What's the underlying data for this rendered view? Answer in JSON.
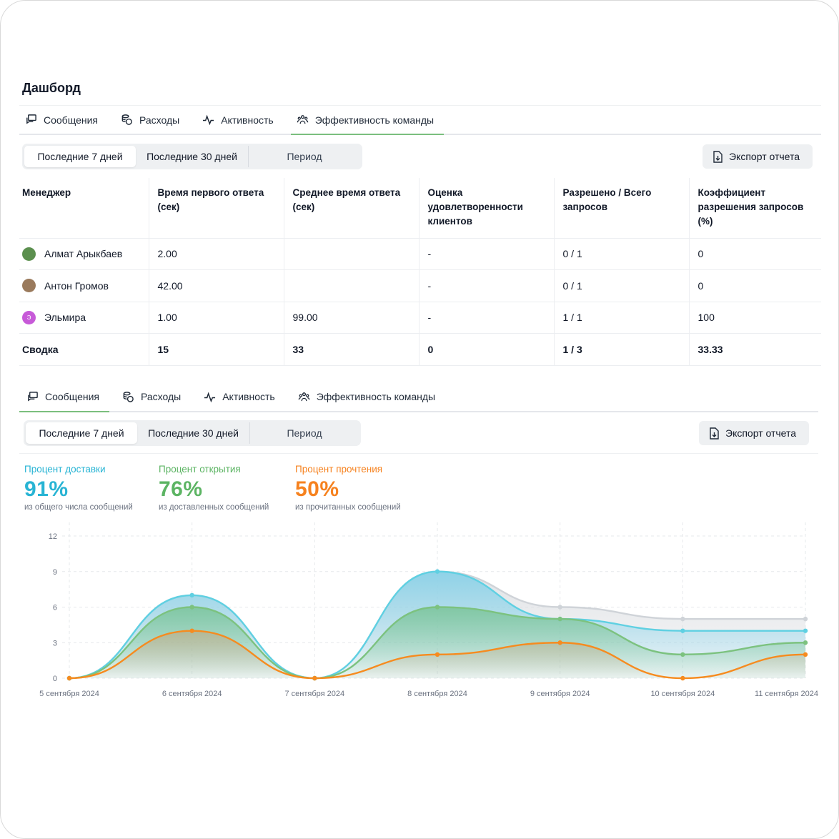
{
  "page_title": "Дашборд",
  "tabs": [
    {
      "label": "Сообщения",
      "icon": "chat-icon"
    },
    {
      "label": "Расходы",
      "icon": "coins-icon"
    },
    {
      "label": "Активность",
      "icon": "pulse-icon"
    },
    {
      "label": "Эффективность команды",
      "icon": "team-icon"
    }
  ],
  "period": {
    "last7": "Последние 7 дней",
    "last30": "Последние 30 дней",
    "custom": "Период"
  },
  "export_label": "Экспорт отчета",
  "table": {
    "headers": [
      "Менеджер",
      "Время первого ответа (сек)",
      "Среднее время ответа (сек)",
      "Оценка удовлетворенности клиентов",
      "Разрешено / Всего запросов",
      "Коэффициент разрешения запросов (%)"
    ],
    "rows": [
      {
        "initial": "",
        "name": "Алмат Арыкбаев",
        "first": "2.00",
        "avg": "",
        "csat": "-",
        "resolved": "0 / 1",
        "rate": "0"
      },
      {
        "initial": "",
        "name": "Антон Громов",
        "first": "42.00",
        "avg": "",
        "csat": "-",
        "resolved": "0 / 1",
        "rate": "0"
      },
      {
        "initial": "Э",
        "name": "Эльмира",
        "first": "1.00",
        "avg": "99.00",
        "csat": "-",
        "resolved": "1 / 1",
        "rate": "100"
      }
    ],
    "summary": {
      "label": "Сводка",
      "first": "15",
      "avg": "33",
      "csat": "0",
      "resolved": "1 / 3",
      "rate": "33.33"
    }
  },
  "metrics": [
    {
      "label": "Процент доставки",
      "value": "91%",
      "sub": "из общего числа сообщений",
      "color": "#28b4d4"
    },
    {
      "label": "Процент открытия",
      "value": "76%",
      "sub": "из доставленных сообщений",
      "color": "#5cb463"
    },
    {
      "label": "Процент прочтения",
      "value": "50%",
      "sub": "из прочитанных сообщений",
      "color": "#f6821f"
    }
  ],
  "chart_data": {
    "type": "area",
    "categories": [
      "5 сентября 2024",
      "6 сентября 2024",
      "7 сентября 2024",
      "8 сентября 2024",
      "9 сентября 2024",
      "10 сентября 2024",
      "11 сентября 2024"
    ],
    "ylim": [
      0,
      12
    ],
    "yticks": [
      "0",
      "3",
      "6",
      "9",
      "12"
    ],
    "grid": true,
    "series": [
      {
        "values": [
          0,
          7,
          0,
          9,
          6,
          5,
          5
        ],
        "color": "#cfd3d8"
      },
      {
        "values": [
          0,
          7,
          0,
          9,
          5,
          4,
          4
        ],
        "color": "#5fd0e2"
      },
      {
        "values": [
          0,
          6,
          0,
          6,
          5,
          2,
          3
        ],
        "color": "#7cc27f"
      },
      {
        "values": [
          0,
          4,
          0,
          2,
          3,
          0,
          2
        ],
        "color": "#f68b1f"
      }
    ]
  }
}
